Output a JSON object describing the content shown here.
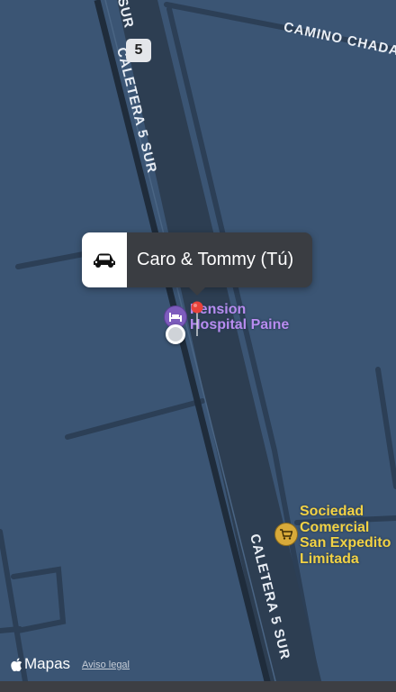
{
  "map": {
    "background_color": "#3b5574",
    "road_labels": {
      "caletera_top": "CALETERA 5 SUR",
      "caletera_bottom": "CALETERA 5 SUR",
      "sur_fragment": "SUR",
      "camino": "CAMINO CHADA"
    },
    "shield": "5"
  },
  "callout": {
    "icon": "car-icon",
    "title": "Caro & Tommy (Tú)"
  },
  "pois": {
    "pension": {
      "icon": "bed-icon",
      "color": "#b88cf0",
      "line1": "Pension",
      "line2": "Hospital Paine"
    },
    "store": {
      "icon": "shopping-cart-icon",
      "color": "#f2d245",
      "line1": "Sociedad",
      "line2": "Comercial",
      "line3": "San Expedito",
      "line4": "Limitada"
    }
  },
  "footer": {
    "brand": "Mapas",
    "brand_icon": "apple-logo-icon",
    "legal": "Aviso legal"
  }
}
